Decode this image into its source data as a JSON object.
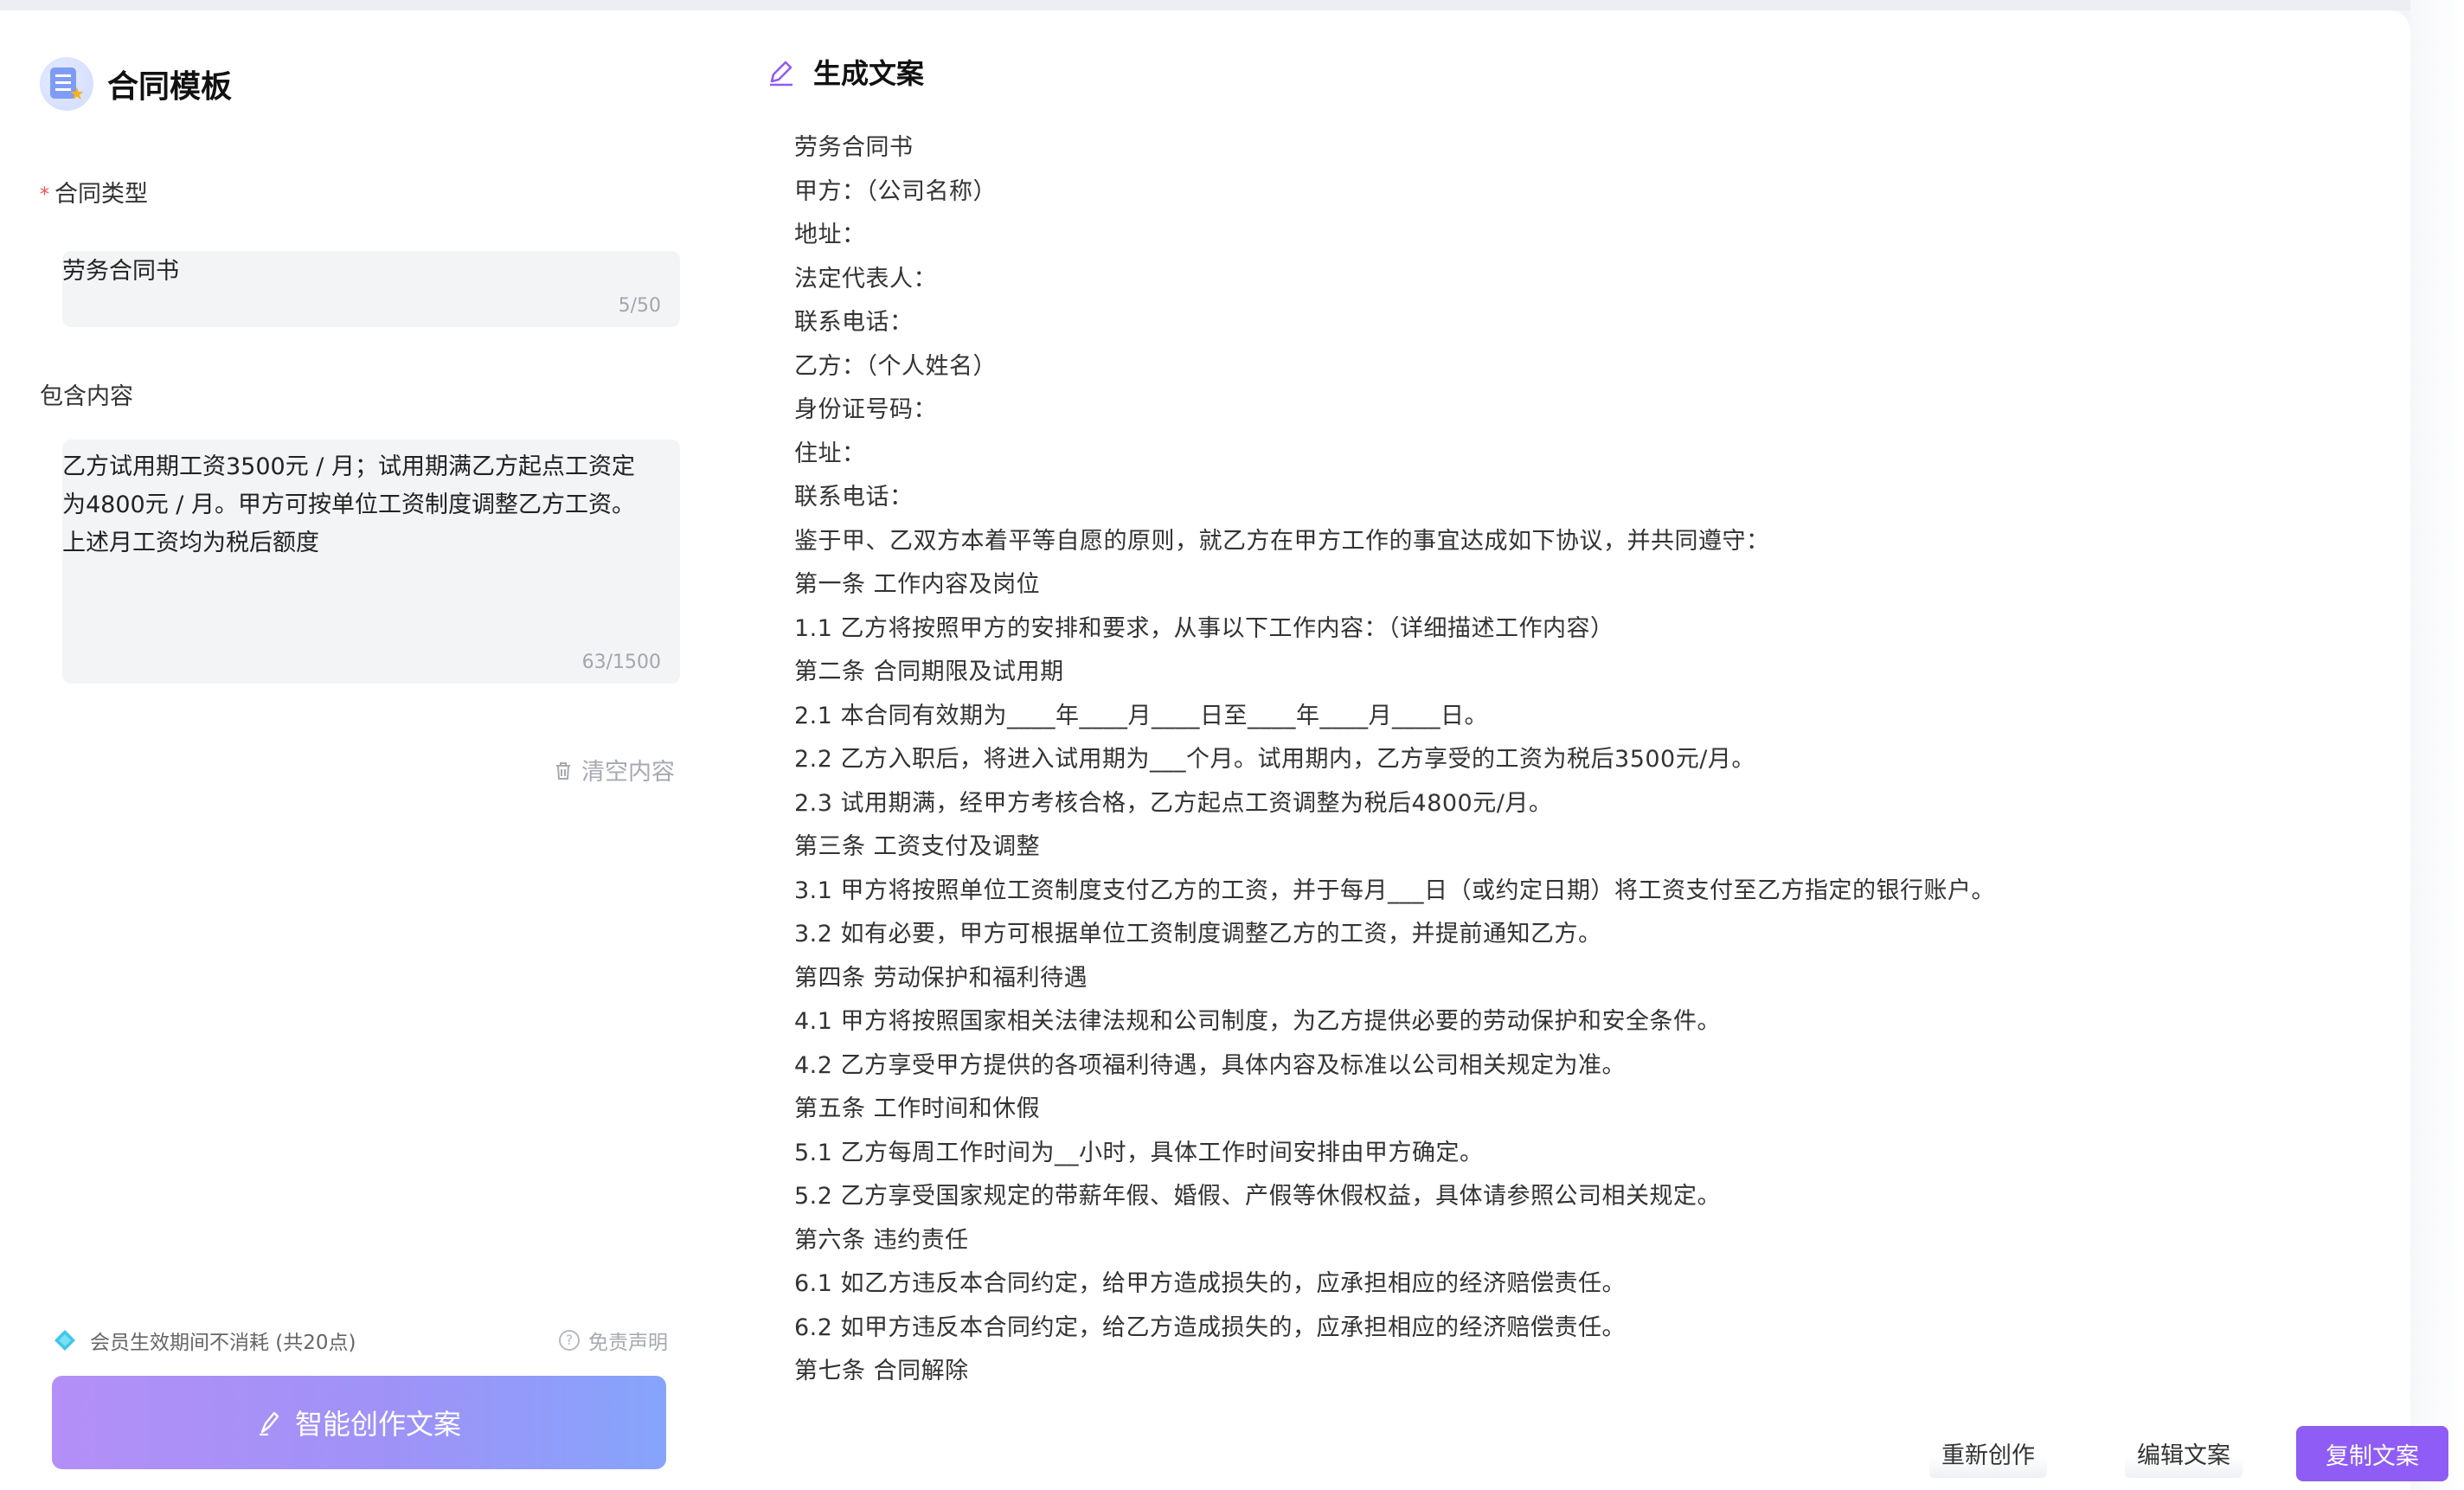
{
  "left": {
    "title": "合同模板",
    "contract_type": {
      "label": "合同类型",
      "value": "劳务合同书",
      "counter": "5/50"
    },
    "content": {
      "label": "包含内容",
      "value": "乙方试用期工资3500元 / 月；试用期满乙方起点工资定\n为4800元 / 月。甲方可按单位工资制度调整乙方工资。\n上述月工资均为税后额度",
      "counter": "63/1500"
    },
    "clear_label": "清空内容",
    "member_note": "会员生效期间不消耗 (共20点)",
    "disclaimer": "免责声明",
    "create_button": "智能创作文案"
  },
  "right": {
    "title": "生成文案",
    "lines": [
      "劳务合同书",
      "甲方：（公司名称）",
      "地址：",
      "法定代表人：",
      "联系电话：",
      "乙方：（个人姓名）",
      "身份证号码：",
      "住址：",
      "联系电话：",
      "鉴于甲、乙双方本着平等自愿的原则，就乙方在甲方工作的事宜达成如下协议，并共同遵守：",
      "第一条 工作内容及岗位",
      "1.1 乙方将按照甲方的安排和要求，从事以下工作内容：（详细描述工作内容）",
      "第二条 合同期限及试用期",
      "2.1 本合同有效期为____年____月____日至____年____月____日。",
      "2.2 乙方入职后，将进入试用期为___个月。试用期内，乙方享受的工资为税后3500元/月。",
      "2.3 试用期满，经甲方考核合格，乙方起点工资调整为税后4800元/月。",
      "第三条 工资支付及调整",
      "3.1 甲方将按照单位工资制度支付乙方的工资，并于每月___日（或约定日期）将工资支付至乙方指定的银行账户。",
      "3.2 如有必要，甲方可根据单位工资制度调整乙方的工资，并提前通知乙方。",
      "第四条 劳动保护和福利待遇",
      "4.1 甲方将按照国家相关法律法规和公司制度，为乙方提供必要的劳动保护和安全条件。",
      "4.2 乙方享受甲方提供的各项福利待遇，具体内容及标准以公司相关规定为准。",
      "第五条 工作时间和休假",
      "5.1 乙方每周工作时间为__小时，具体工作时间安排由甲方确定。",
      "5.2 乙方享受国家规定的带薪年假、婚假、产假等休假权益，具体请参照公司相关规定。",
      "第六条 违约责任",
      "6.1 如乙方违反本合同约定，给甲方造成损失的，应承担相应的经济赔偿责任。",
      "6.2 如甲方违反本合同约定，给乙方造成损失的，应承担相应的经济赔偿责任。",
      "第七条 合同解除"
    ],
    "actions": {
      "regenerate": "重新创作",
      "edit": "编辑文案",
      "copy": "复制文案"
    }
  },
  "colors": {
    "accent": "#8f5cf5",
    "create_gradient_start": "#b38ff7",
    "create_gradient_end": "#86a4fb",
    "required": "#ff4d4f"
  },
  "icons": {
    "brand": "contract-template-icon",
    "clear": "trash-icon",
    "member": "diamond-icon",
    "disclaimer": "question-circle-icon",
    "create": "magic-pen-icon",
    "generated": "edit-pen-icon"
  }
}
